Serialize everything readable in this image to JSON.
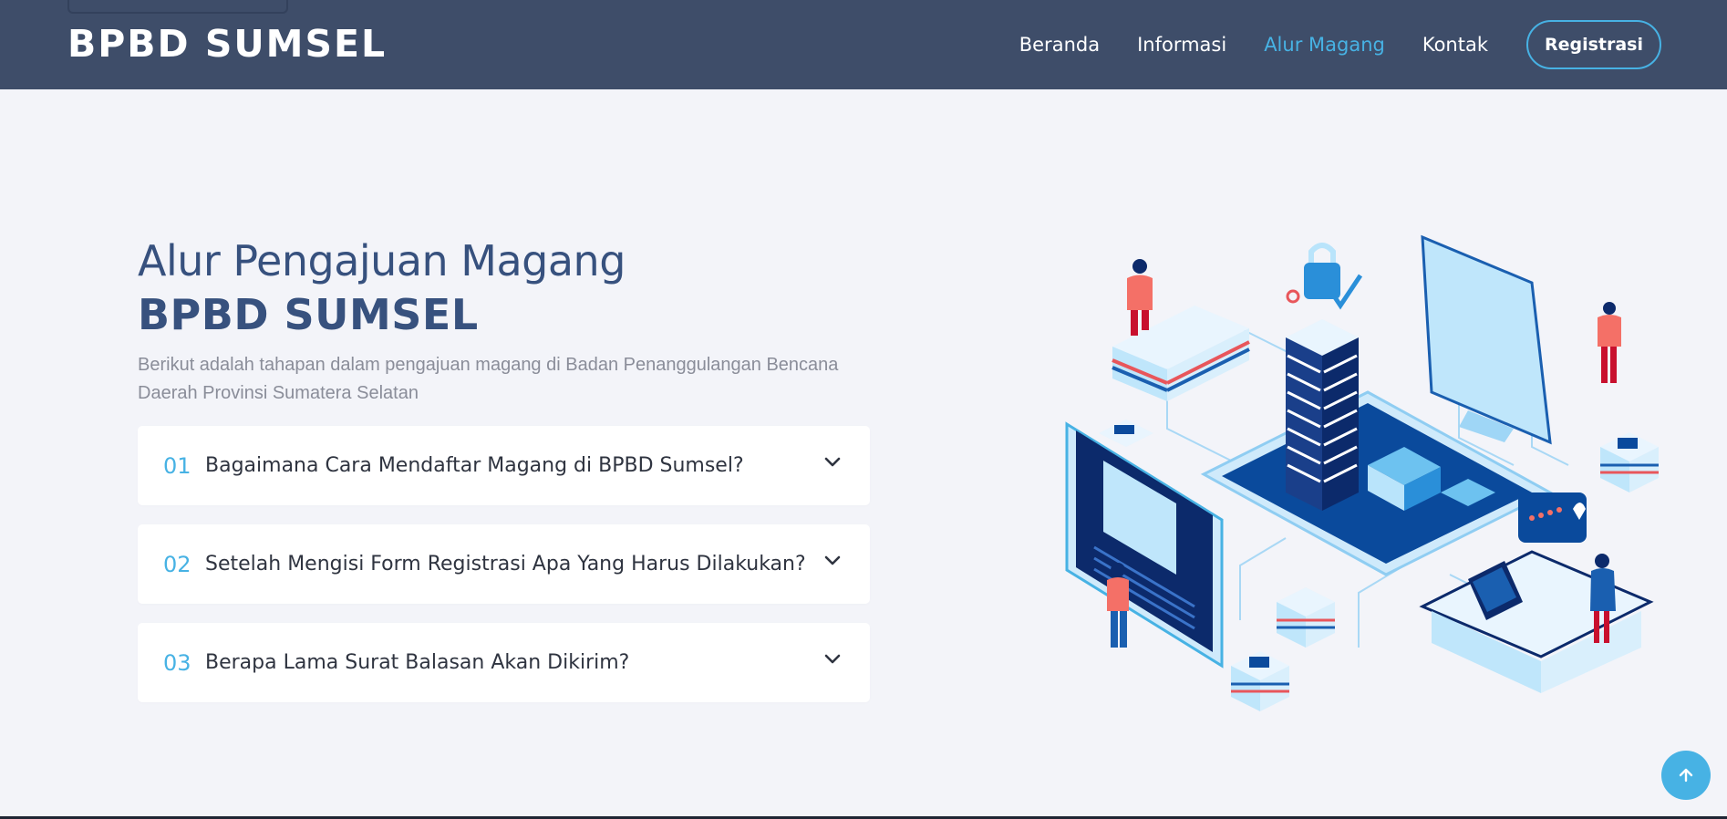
{
  "header": {
    "logo": "BPBD SUMSEL",
    "nav": [
      "Beranda",
      "Informasi",
      "Alur Magang",
      "Kontak"
    ],
    "active": "Alur Magang",
    "register_label": "Registrasi"
  },
  "main": {
    "title_line1": "Alur Pengajuan Magang",
    "title_line2": "BPBD SUMSEL",
    "description": "Berikut adalah tahapan dalam pengajuan magang di Badan Penanggulangan Bencana Daerah Provinsi Sumatera Selatan",
    "faq": [
      {
        "num": "01",
        "question": "Bagaimana Cara Mendaftar Magang di BPBD Sumsel?"
      },
      {
        "num": "02",
        "question": "Setelah Mengisi Form Registrasi Apa Yang Harus Dilakukan?"
      },
      {
        "num": "03",
        "question": "Berapa Lama Surat Balasan Akan Dikirim?"
      }
    ]
  },
  "colors": {
    "header_bg": "#3e4d69",
    "accent": "#47b2e4",
    "title": "#37517e",
    "page_bg": "#f3f4f9"
  },
  "icons": {
    "faq_toggle": "chevron-down-icon",
    "back_to_top": "arrow-up-icon"
  }
}
